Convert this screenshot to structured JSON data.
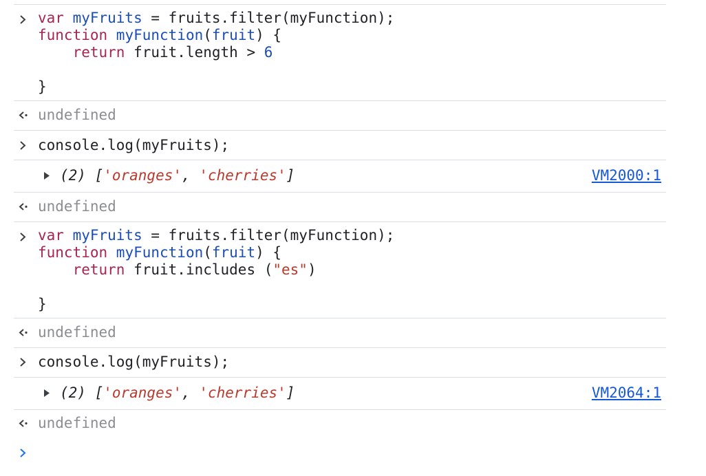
{
  "console": {
    "entries": [
      {
        "kind": "input",
        "lines": [
          [
            "var ",
            "myFruits",
            " = fruits.filter(myFunction);"
          ],
          [
            "function ",
            "myFunction",
            "(",
            "fruit",
            ") {"
          ],
          [
            "    ",
            "return",
            " fruit.length > ",
            "6"
          ],
          [
            ""
          ],
          [
            "}"
          ]
        ]
      },
      {
        "kind": "result",
        "text": "undefined"
      },
      {
        "kind": "input",
        "lines": [
          [
            "console.log(myFruits);"
          ]
        ]
      },
      {
        "kind": "log",
        "prefix": "(2) [",
        "items": [
          "'oranges'",
          "'cherries'"
        ],
        "separator": ", ",
        "suffix": "]",
        "source": "VM2000:1"
      },
      {
        "kind": "result",
        "text": "undefined"
      },
      {
        "kind": "input",
        "lines": [
          [
            "var ",
            "myFruits",
            " = fruits.filter(myFunction);"
          ],
          [
            "function ",
            "myFunction",
            "(",
            "fruit",
            ") {"
          ],
          [
            "    ",
            "return",
            " fruit.includes (",
            "\"es\"",
            ")"
          ],
          [
            ""
          ],
          [
            "}"
          ]
        ]
      },
      {
        "kind": "result",
        "text": "undefined"
      },
      {
        "kind": "input",
        "lines": [
          [
            "console.log(myFruits);"
          ]
        ]
      },
      {
        "kind": "log",
        "prefix": "(2) [",
        "items": [
          "'oranges'",
          "'cherries'"
        ],
        "separator": ", ",
        "suffix": "]",
        "source": "VM2064:1"
      },
      {
        "kind": "result",
        "text": "undefined"
      }
    ],
    "colors": {
      "keyword": "#a8254d",
      "function_name": "#1a4db8",
      "number": "#1a4db8",
      "string": "#b93a2d",
      "muted": "#8a8d91",
      "link": "#1558d6",
      "separator": "#d7dee8",
      "active_prompt": "#1a73e8"
    },
    "icons": {
      "input_prompt": "chevron-right-icon",
      "result_prompt": "return-arrow-icon",
      "expand": "triangle-right-icon"
    }
  }
}
